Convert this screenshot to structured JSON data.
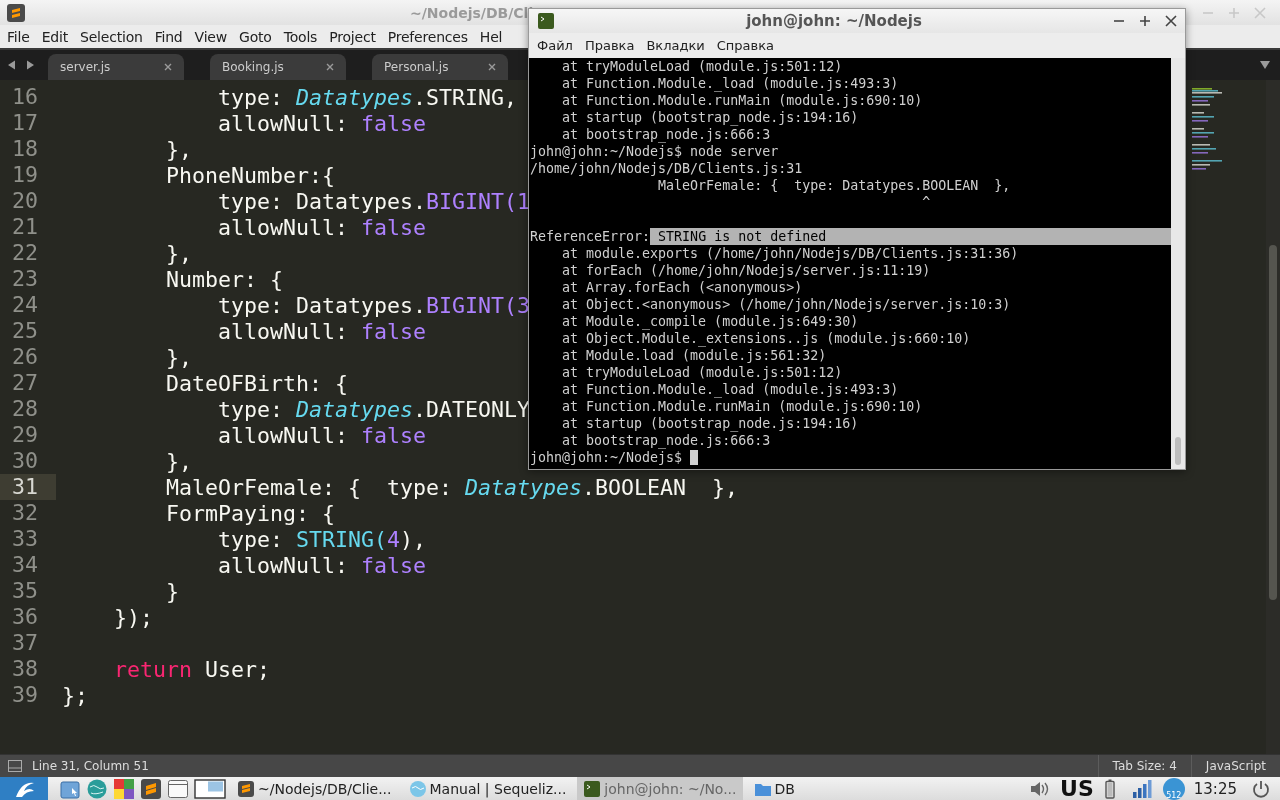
{
  "editor": {
    "title": "~/Nodejs/DB/Cli",
    "menu": [
      "File",
      "Edit",
      "Selection",
      "Find",
      "View",
      "Goto",
      "Tools",
      "Project",
      "Preferences",
      "Hel"
    ],
    "tabs": [
      {
        "label": "server.js"
      },
      {
        "label": "Booking.js"
      },
      {
        "label": "Personal.js"
      }
    ],
    "lines": [
      {
        "number": "16",
        "current": false,
        "tokens": [
          {
            "text": "            type: ",
            "kind": "plain"
          },
          {
            "text": "Datatypes",
            "kind": "type"
          },
          {
            "text": ".STRING,",
            "kind": "plain"
          }
        ]
      },
      {
        "number": "17",
        "current": false,
        "tokens": [
          {
            "text": "            allowNull: ",
            "kind": "plain"
          },
          {
            "text": "false",
            "kind": "const"
          }
        ]
      },
      {
        "number": "18",
        "current": false,
        "tokens": [
          {
            "text": "        },",
            "kind": "plain"
          }
        ]
      },
      {
        "number": "19",
        "current": false,
        "tokens": [
          {
            "text": "        PhoneNumber:{",
            "kind": "plain"
          }
        ]
      },
      {
        "number": "20",
        "current": false,
        "tokens": [
          {
            "text": "            type: Datatypes.",
            "kind": "plain"
          },
          {
            "text": "BIGINT(1",
            "kind": "const"
          }
        ]
      },
      {
        "number": "21",
        "current": false,
        "tokens": [
          {
            "text": "            allowNull: ",
            "kind": "plain"
          },
          {
            "text": "false",
            "kind": "const"
          }
        ]
      },
      {
        "number": "22",
        "current": false,
        "tokens": [
          {
            "text": "        },",
            "kind": "plain"
          }
        ]
      },
      {
        "number": "23",
        "current": false,
        "tokens": [
          {
            "text": "        Number: {",
            "kind": "plain"
          }
        ]
      },
      {
        "number": "24",
        "current": false,
        "tokens": [
          {
            "text": "            type: Datatypes.",
            "kind": "plain"
          },
          {
            "text": "BIGINT(3",
            "kind": "const"
          }
        ]
      },
      {
        "number": "25",
        "current": false,
        "tokens": [
          {
            "text": "            allowNull: ",
            "kind": "plain"
          },
          {
            "text": "false",
            "kind": "const"
          }
        ]
      },
      {
        "number": "26",
        "current": false,
        "tokens": [
          {
            "text": "        },",
            "kind": "plain"
          }
        ]
      },
      {
        "number": "27",
        "current": false,
        "tokens": [
          {
            "text": "        DateOFBirth: {",
            "kind": "plain"
          }
        ]
      },
      {
        "number": "28",
        "current": false,
        "tokens": [
          {
            "text": "            type: ",
            "kind": "plain"
          },
          {
            "text": "Datatypes",
            "kind": "type"
          },
          {
            "text": ".DATEONLY",
            "kind": "plain"
          }
        ]
      },
      {
        "number": "29",
        "current": false,
        "tokens": [
          {
            "text": "            allowNull: ",
            "kind": "plain"
          },
          {
            "text": "false",
            "kind": "const"
          }
        ]
      },
      {
        "number": "30",
        "current": false,
        "tokens": [
          {
            "text": "        },",
            "kind": "plain"
          }
        ]
      },
      {
        "number": "31",
        "current": true,
        "tokens": [
          {
            "text": "        MaleOrFemale: {  type: ",
            "kind": "plain"
          },
          {
            "text": "Datatypes",
            "kind": "type"
          },
          {
            "text": ".BOOLEAN  },",
            "kind": "plain"
          }
        ]
      },
      {
        "number": "32",
        "current": false,
        "tokens": [
          {
            "text": "        FormPaying: {",
            "kind": "plain"
          }
        ]
      },
      {
        "number": "33",
        "current": false,
        "tokens": [
          {
            "text": "            type: ",
            "kind": "plain"
          },
          {
            "text": "STRING(",
            "kind": "func"
          },
          {
            "text": "4",
            "kind": "const"
          },
          {
            "text": "),",
            "kind": "plain"
          }
        ]
      },
      {
        "number": "34",
        "current": false,
        "tokens": [
          {
            "text": "            allowNull: ",
            "kind": "plain"
          },
          {
            "text": "false",
            "kind": "const"
          }
        ]
      },
      {
        "number": "35",
        "current": false,
        "tokens": [
          {
            "text": "        }",
            "kind": "plain"
          }
        ]
      },
      {
        "number": "36",
        "current": false,
        "tokens": [
          {
            "text": "    });",
            "kind": "plain"
          }
        ]
      },
      {
        "number": "37",
        "current": false
      },
      {
        "number": "38",
        "current": false,
        "tokens": [
          {
            "text": "    return",
            "kind": "keyword"
          },
          {
            "text": " User;",
            "kind": "plain"
          }
        ]
      },
      {
        "number": "39",
        "current": false,
        "tokens": [
          {
            "text": "};",
            "kind": "plain"
          }
        ]
      }
    ],
    "status": {
      "position": "Line 31, Column 51",
      "tab_size": "Tab Size: 4",
      "syntax": "JavaScript"
    }
  },
  "terminal": {
    "title": "john@john: ~/Nodejs",
    "menu": [
      "Файл",
      "Правка",
      "Вкладки",
      "Справка"
    ],
    "lines": [
      {
        "kind": "text",
        "text": "    at tryModuleLoad (module.js:501:12)"
      },
      {
        "kind": "text",
        "text": "    at Function.Module._load (module.js:493:3)"
      },
      {
        "kind": "text",
        "text": "    at Function.Module.runMain (module.js:690:10)"
      },
      {
        "kind": "text",
        "text": "    at startup (bootstrap_node.js:194:16)"
      },
      {
        "kind": "text",
        "text": "    at bootstrap_node.js:666:3"
      },
      {
        "kind": "text",
        "text": "john@john:~/Nodejs$ node server"
      },
      {
        "kind": "text",
        "text": "/home/john/Nodejs/DB/Clients.js:31"
      },
      {
        "kind": "text",
        "text": "                MaleOrFemale: {  type: Datatypes.BOOLEAN  },"
      },
      {
        "kind": "text",
        "text": "                                                 ^"
      },
      {
        "kind": "blank"
      },
      {
        "kind": "text",
        "text": "ReferenceError:",
        "selection": " STRING is not defined"
      },
      {
        "kind": "text",
        "text": "    at module.exports (/home/john/Nodejs/DB/Clients.js:31:36)"
      },
      {
        "kind": "text",
        "text": "    at forEach (/home/john/Nodejs/server.js:11:19)"
      },
      {
        "kind": "text",
        "text": "    at Array.forEach (<anonymous>)"
      },
      {
        "kind": "text",
        "text": "    at Object.<anonymous> (/home/john/Nodejs/server.js:10:3)"
      },
      {
        "kind": "text",
        "text": "    at Module._compile (module.js:649:30)"
      },
      {
        "kind": "text",
        "text": "    at Object.Module._extensions..js (module.js:660:10)"
      },
      {
        "kind": "text",
        "text": "    at Module.load (module.js:561:32)"
      },
      {
        "kind": "text",
        "text": "    at tryModuleLoad (module.js:501:12)"
      },
      {
        "kind": "text",
        "text": "    at Function.Module._load (module.js:493:3)"
      },
      {
        "kind": "text",
        "text": "    at Function.Module.runMain (module.js:690:10)"
      },
      {
        "kind": "text",
        "text": "    at startup (bootstrap_node.js:194:16)"
      },
      {
        "kind": "text",
        "text": "    at bootstrap_node.js:666:3"
      },
      {
        "kind": "text",
        "text": "john@john:~/Nodejs$ ",
        "cursor": true
      }
    ]
  },
  "taskbar": {
    "tasks": [
      {
        "kind": "editor",
        "label": "~/Nodejs/DB/Clie...",
        "selected": false
      },
      {
        "kind": "browser",
        "label": "Manual | Sequeliz...",
        "selected": false
      },
      {
        "kind": "terminal",
        "label": "john@john: ~/No...",
        "selected": true
      },
      {
        "kind": "folder",
        "label": "DB",
        "selected": false
      }
    ],
    "keyboard": "US",
    "update_badge": "512",
    "clock": "13:25"
  }
}
